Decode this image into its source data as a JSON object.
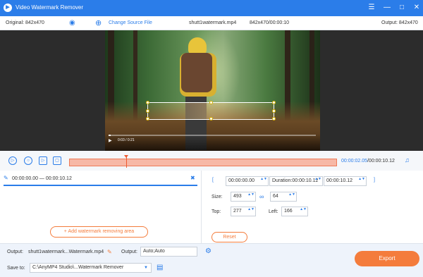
{
  "titlebar": {
    "title": "Video Watermark Remover",
    "logo_glyph": "▶",
    "pin_glyph": "☰",
    "minimize_glyph": "—",
    "maximize_glyph": "□",
    "close_glyph": "✕"
  },
  "infobar": {
    "original": "Original: 842x470",
    "eye_glyph": "◉",
    "change_source": "Change Source File",
    "plus_glyph": "⊕",
    "filename": "shutt1watermark.mp4",
    "file_info": "842x470/00:00:10",
    "output": "Output: 842x470"
  },
  "video": {
    "play_glyph": "▶",
    "time": "0:03 / 0:21"
  },
  "player": {
    "play_glyph": "▷",
    "stop_glyph": "○",
    "next_glyph": "▷",
    "loop_glyph": "▢",
    "current_time": "00:00:02.05",
    "total_time": "/00:00:10.12",
    "volume_glyph": "♫"
  },
  "segment": {
    "range": "00:00:00.00 — 00:00:10.12",
    "delete_glyph": "✖",
    "brush_glyph": "✎"
  },
  "add_area_label": "Add watermark removing area",
  "add_area_plus": "+",
  "editor": {
    "bracket_open": "[",
    "bracket_close": "]",
    "start_time": "00:00:00.00",
    "duration": "Duration:00:00:10.12",
    "end_time": "00:00:10.12",
    "size_label": "Size:",
    "width": "493",
    "height": "64",
    "link_glyph": "∞",
    "top_label": "Top:",
    "top": "277",
    "left_label": "Left:",
    "left": "166",
    "spin_glyph": "▲▼",
    "reset_label": "Reset"
  },
  "bottom": {
    "output_label": "Output:",
    "output_file": "shutt1watermark...Watermark.mp4",
    "pencil_glyph": "✎",
    "format_label": "Output:",
    "format_value": "Auto;Auto",
    "settings_glyph": "⚙",
    "save_label": "Save to:",
    "save_path": "C:\\AnyMP4 Studio\\...Watermark Remover",
    "dropdown_glyph": "▼",
    "folder_glyph": "▤",
    "export_label": "Export"
  },
  "colors": {
    "accent": "#2b7de9",
    "orange": "#f47c3c"
  }
}
